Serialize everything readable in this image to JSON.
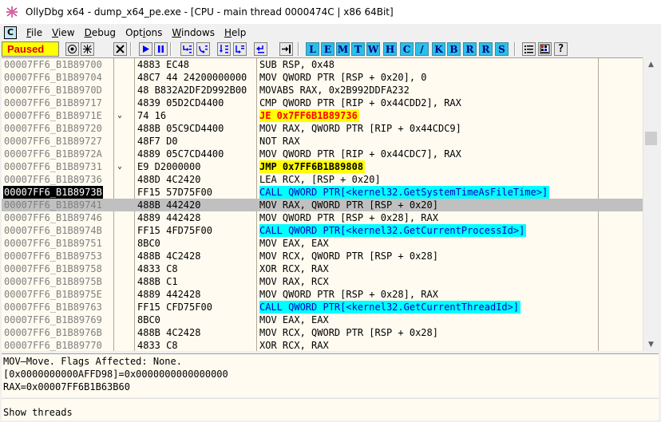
{
  "window": {
    "title": "OllyDbg x64 - dump_x64_pe.exe - [CPU - main thread 0000474C | x86 64Bit]"
  },
  "menu": {
    "mdi_icon": "C",
    "items": [
      "File",
      "View",
      "Debug",
      "Options",
      "Windows",
      "Help"
    ]
  },
  "toolbar": {
    "status": "Paused",
    "buttons": [
      "open-icon",
      "restart-icon",
      "close-icon",
      "run-icon",
      "pause-icon",
      "step-into-icon",
      "step-over-icon",
      "trace-into-icon",
      "trace-over-icon",
      "execute-till-return-icon",
      "goto-icon"
    ],
    "letters": [
      "L",
      "E",
      "M",
      "T",
      "W",
      "H",
      "C",
      "/",
      "K",
      "B",
      "R",
      "R",
      "S"
    ],
    "extra_buttons": [
      "list-icon",
      "grid-icon",
      "help-icon"
    ]
  },
  "disasm": {
    "rows": [
      {
        "addr": "00007FF6_B1B89700",
        "hex": "4883 EC48",
        "cmd": "SUB RSP, 0x48",
        "style": ""
      },
      {
        "addr": "00007FF6_B1B89704",
        "hex": "48C7 44 24200000000",
        "cmd": "MOV QWORD PTR [RSP + 0x20], 0",
        "style": ""
      },
      {
        "addr": "00007FF6_B1B8970D",
        "hex": "48 B832A2DF2D992B00",
        "cmd": "MOVABS RAX, 0x2B992DDFA232",
        "style": ""
      },
      {
        "addr": "00007FF6_B1B89717",
        "hex": "4839 05D2CD4400",
        "cmd": "CMP QWORD PTR [RIP + 0x44CDD2], RAX",
        "style": ""
      },
      {
        "addr": "00007FF6_B1B8971E",
        "hex": "74 16",
        "cmd": "JE 0x7FF6B1B89736",
        "style": "hl-yellow",
        "mark": "⌄"
      },
      {
        "addr": "00007FF6_B1B89720",
        "hex": "488B 05C9CD4400",
        "cmd": "MOV RAX, QWORD PTR [RIP + 0x44CDC9]",
        "style": ""
      },
      {
        "addr": "00007FF6_B1B89727",
        "hex": "48F7 D0",
        "cmd": "NOT RAX",
        "style": ""
      },
      {
        "addr": "00007FF6_B1B8972A",
        "hex": "4889 05C7CD4400",
        "cmd": "MOV QWORD PTR [RIP + 0x44CDC7], RAX",
        "style": ""
      },
      {
        "addr": "00007FF6_B1B89731",
        "hex": "E9 D2000000",
        "cmd": "JMP 0x7FF6B1B89808",
        "style": "hl-yellow2",
        "mark": "⌄"
      },
      {
        "addr": "00007FF6_B1B89736",
        "hex": "488D 4C2420",
        "cmd": "LEA RCX, [RSP + 0x20]",
        "style": ""
      },
      {
        "addr": "00007FF6_B1B8973B",
        "hex": "FF15 57D75F00",
        "cmd": "CALL QWORD PTR[<kernel32.GetSystemTimeAsFileTime>]",
        "style": "hl-cyan",
        "current": true
      },
      {
        "addr": "00007FF6_B1B89741",
        "hex": "488B 442420",
        "cmd": "MOV RAX, QWORD PTR [RSP + 0x20]",
        "style": "",
        "selected": true
      },
      {
        "addr": "00007FF6_B1B89746",
        "hex": "4889 442428",
        "cmd": "MOV QWORD PTR [RSP + 0x28], RAX",
        "style": ""
      },
      {
        "addr": "00007FF6_B1B8974B",
        "hex": "FF15 4FD75F00",
        "cmd": "CALL QWORD PTR[<kernel32.GetCurrentProcessId>]",
        "style": "hl-cyan"
      },
      {
        "addr": "00007FF6_B1B89751",
        "hex": "8BC0",
        "cmd": "MOV EAX, EAX",
        "style": ""
      },
      {
        "addr": "00007FF6_B1B89753",
        "hex": "488B 4C2428",
        "cmd": "MOV RCX, QWORD PTR [RSP + 0x28]",
        "style": ""
      },
      {
        "addr": "00007FF6_B1B89758",
        "hex": "4833 C8",
        "cmd": "XOR RCX, RAX",
        "style": ""
      },
      {
        "addr": "00007FF6_B1B8975B",
        "hex": "488B C1",
        "cmd": "MOV RAX, RCX",
        "style": ""
      },
      {
        "addr": "00007FF6_B1B8975E",
        "hex": "4889 442428",
        "cmd": "MOV QWORD PTR [RSP + 0x28], RAX",
        "style": ""
      },
      {
        "addr": "00007FF6_B1B89763",
        "hex": "FF15 CFD75F00",
        "cmd": "CALL QWORD PTR[<kernel32.GetCurrentThreadId>]",
        "style": "hl-cyan"
      },
      {
        "addr": "00007FF6_B1B89769",
        "hex": "8BC0",
        "cmd": "MOV EAX, EAX",
        "style": ""
      },
      {
        "addr": "00007FF6_B1B8976B",
        "hex": "488B 4C2428",
        "cmd": "MOV RCX, QWORD PTR [RSP + 0x28]",
        "style": ""
      },
      {
        "addr": "00007FF6_B1B89770",
        "hex": "4833 C8",
        "cmd": "XOR RCX, RAX",
        "style": ""
      }
    ]
  },
  "info": {
    "line1": "MOV—Move. Flags Affected: None.",
    "line2": "[0x0000000000AFFD98]=0x0000000000000000",
    "line3": "RAX=0x00007FF6B1B63B60"
  },
  "statusbar": {
    "text": "Show threads"
  },
  "colors": {
    "pane_bg": "#fffbf0",
    "paused_bg": "#ffff00",
    "paused_fg": "#e00000",
    "jump_highlight": "#ffff00",
    "call_highlight": "#00ffff",
    "selected_row": "#c0c0c0"
  }
}
